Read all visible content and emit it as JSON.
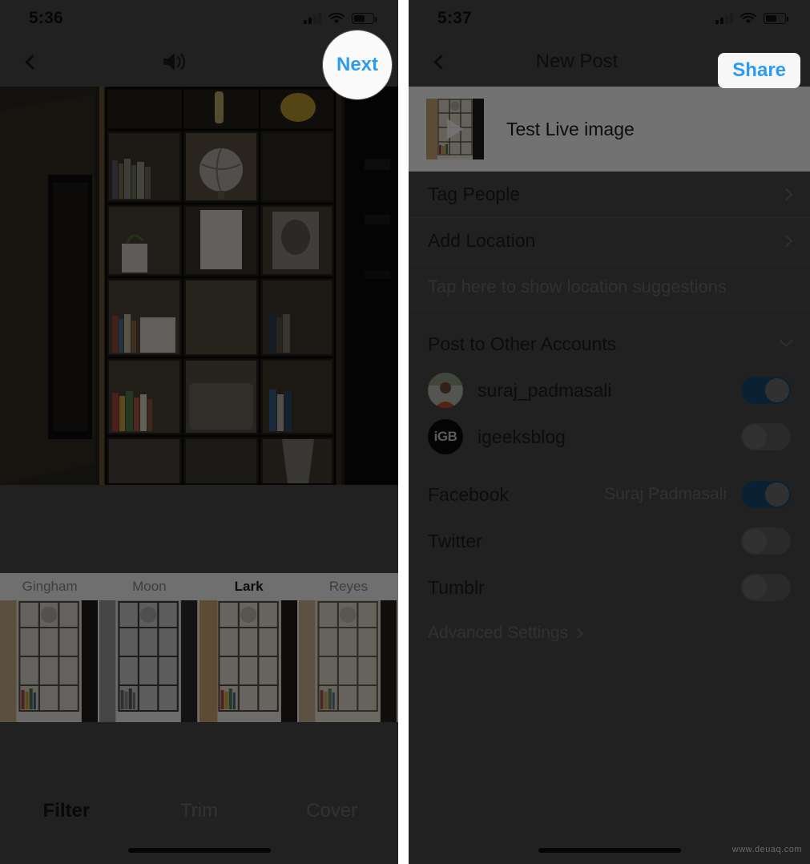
{
  "left_panel": {
    "status_bar": {
      "time": "5:36",
      "cellular_icon": "cellular-bars-icon",
      "wifi_icon": "wifi-icon",
      "battery_icon": "battery-icon"
    },
    "navbar": {
      "back_icon": "chevron-left-icon",
      "sound_icon": "speaker-on-icon",
      "action_label": "Next"
    },
    "filters": {
      "items": [
        {
          "name": "Gingham",
          "selected": false
        },
        {
          "name": "Moon",
          "selected": false
        },
        {
          "name": "Lark",
          "selected": true
        },
        {
          "name": "Reyes",
          "selected": false
        }
      ]
    },
    "mode_tabs": [
      {
        "label": "Filter",
        "selected": true
      },
      {
        "label": "Trim",
        "selected": false
      },
      {
        "label": "Cover",
        "selected": false
      }
    ]
  },
  "right_panel": {
    "status_bar": {
      "time": "5:37",
      "cellular_icon": "cellular-bars-icon",
      "wifi_icon": "wifi-icon",
      "battery_icon": "battery-icon"
    },
    "navbar": {
      "back_icon": "chevron-left-icon",
      "title": "New Post",
      "action_label": "Share"
    },
    "caption": {
      "text": "Test Live image",
      "thumbnail_overlay_icon": "play-icon"
    },
    "rows": [
      {
        "label": "Tag People",
        "accessory": "chevron-right-icon"
      },
      {
        "label": "Add Location",
        "accessory": "chevron-right-icon"
      }
    ],
    "location_hint": "Tap here to show location suggestions",
    "other_accounts": {
      "header": "Post to Other Accounts",
      "accessory": "chevron-down-icon",
      "accounts": [
        {
          "name": "suraj_padmasali",
          "avatar": "user-photo-avatar",
          "enabled": true
        },
        {
          "name": "igeeksblog",
          "avatar": "igb-logo-avatar",
          "avatar_text": "iGB",
          "enabled": false
        }
      ]
    },
    "services": [
      {
        "name": "Facebook",
        "detail": "Suraj Padmasali",
        "enabled": true
      },
      {
        "name": "Twitter",
        "detail": "",
        "enabled": false
      },
      {
        "name": "Tumblr",
        "detail": "",
        "enabled": false
      }
    ],
    "advanced_settings": {
      "label": "Advanced Settings",
      "accessory": "chevron-right-icon"
    }
  },
  "watermark": "www.deuaq.com",
  "colors": {
    "accent_blue": "#2c9cf0",
    "toggle_on": "#16496f",
    "toggle_off": "#5d5d5d",
    "panel_bg": "#4a4a4a",
    "highlight_bg": "#fafafa"
  }
}
